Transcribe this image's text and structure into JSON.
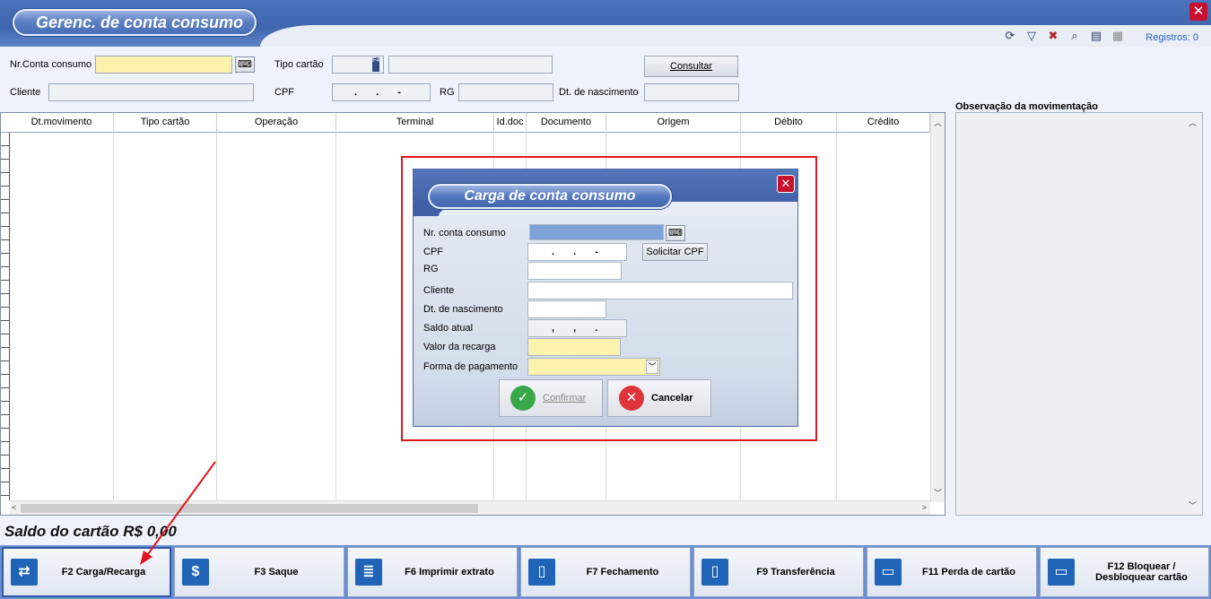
{
  "window": {
    "title": "Gerenc. de conta consumo",
    "close_icon": "close-icon"
  },
  "toolbar": {
    "icons": [
      "refresh-icon",
      "filter-icon",
      "clear-filter-icon",
      "search-icon",
      "print-icon",
      "export-icon"
    ],
    "registros": "Registros: 0"
  },
  "filters": {
    "nr_conta_label": "Nr.Conta consumo",
    "tipo_cartao_label": "Tipo cartão",
    "tipo_cartao_code": "F4",
    "consultar_label": "Consultar",
    "cliente_label": "Cliente",
    "cpf_label": "CPF",
    "cpf_mask": ". . -",
    "rg_label": "RG",
    "dt_nasc_label": "Dt. de nascimento"
  },
  "grid": {
    "columns": [
      "Dt.movimento",
      "Tipo cartão",
      "Operação",
      "Terminal",
      "Id.doc",
      "Documento",
      "Origem",
      "Débito",
      "Crédito"
    ]
  },
  "obs": {
    "label": "Observação da movimentação"
  },
  "saldo": "Saldo do cartão R$ 0,00",
  "fbuttons": [
    {
      "label": "F2 Carga/Recarga",
      "icon": "recharge-icon"
    },
    {
      "label": "F3 Saque",
      "icon": "cash-icon"
    },
    {
      "label": "F6 Imprimir extrato",
      "icon": "statement-icon"
    },
    {
      "label": "F7 Fechamento",
      "icon": "closing-icon"
    },
    {
      "label": "F9 Transferência",
      "icon": "transfer-icon"
    },
    {
      "label": "F11 Perda de cartão",
      "icon": "card-lost-icon"
    },
    {
      "label": "F12 Bloquear / Desbloquear cartão",
      "icon": "card-block-icon"
    }
  ],
  "dialog": {
    "title": "Carga de conta consumo",
    "nr_conta_label": "Nr. conta consumo",
    "cpf_label": "CPF",
    "cpf_mask": ". . -",
    "solicitar_cpf": "Solicitar CPF",
    "rg_label": "RG",
    "cliente_label": "Cliente",
    "dt_nasc_label": "Dt. de nascimento",
    "saldo_label": "Saldo atual",
    "saldo_mask": ", , .",
    "valor_label": "Valor da recarga",
    "forma_label": "Forma de pagamento",
    "confirmar": "Confirmar",
    "cancelar": "Cancelar"
  },
  "colors": {
    "accent": "#3f66ae",
    "highlight": "#e0161d",
    "field_yellow": "#fbf3ad"
  }
}
